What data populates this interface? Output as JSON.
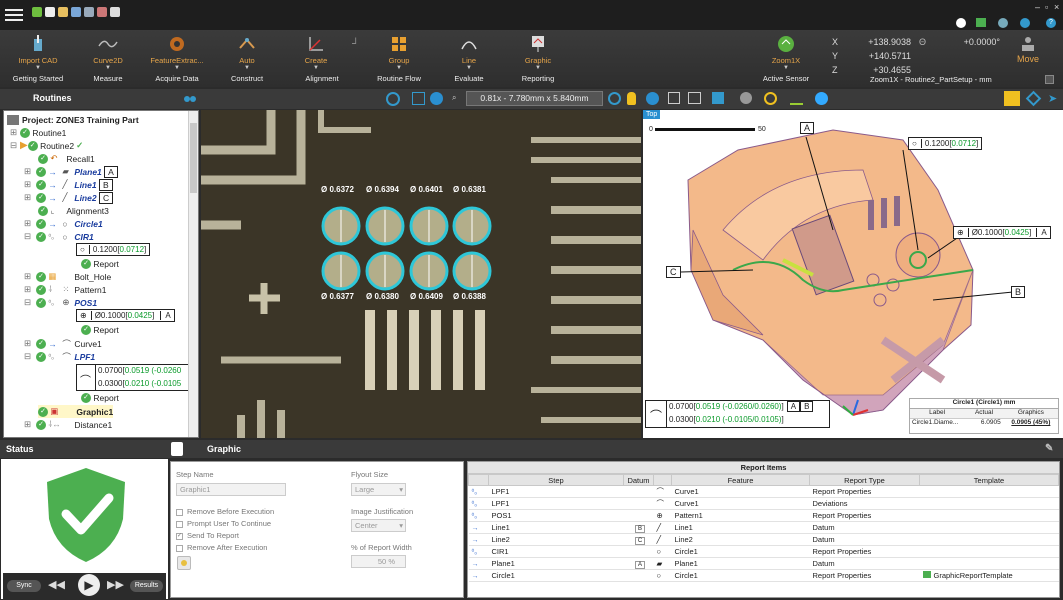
{
  "window": {
    "min": "–",
    "max": "▫",
    "close": "×"
  },
  "ribbon": {
    "buttons": [
      {
        "label": "Import CAD"
      },
      {
        "label": "Curve2D"
      },
      {
        "label": "FeatureExtrac..."
      },
      {
        "label": "Auto"
      },
      {
        "label": "Create"
      },
      {
        "label": "Group"
      },
      {
        "label": "Line"
      },
      {
        "label": "Graphic"
      },
      {
        "label": "Zoom1X"
      }
    ],
    "groups": [
      "Getting Started",
      "Measure",
      "Acquire Data",
      "Construct",
      "Alignment",
      "Routine Flow",
      "Evaluate",
      "Reporting",
      "Active Sensor"
    ],
    "coords": {
      "x_label": "X",
      "y_label": "Y",
      "z_label": "Z",
      "x": "+138.9038",
      "y": "+140.5711",
      "z": "+30.4655",
      "angle": "+0.0000°"
    },
    "move_label": "Move",
    "sensor_info": "Zoom1X - Routine2_PartSetup - mm"
  },
  "routines_title": "Routines",
  "viewport": {
    "zoom_text": "0.81x - 7.780mm x 5.840mm"
  },
  "tree": {
    "project": "Project: ZONE3 Training Part",
    "items": [
      {
        "label": "Routine1"
      },
      {
        "label": "Routine2"
      },
      {
        "label": "Recall1"
      },
      {
        "label": "Plane1",
        "datum": "A"
      },
      {
        "label": "Line1",
        "datum": "B"
      },
      {
        "label": "Line2",
        "datum": "C"
      },
      {
        "label": "Alignment3"
      },
      {
        "label": "Circle1"
      },
      {
        "label": "CIR1"
      },
      {
        "label": "0.1200",
        "tol": "0.0712"
      },
      {
        "label": "Report"
      },
      {
        "label": "Bolt_Hole"
      },
      {
        "label": "Pattern1"
      },
      {
        "label": "POS1"
      },
      {
        "label": "Ø0.1000",
        "tol": "0.0425",
        "datum": "A"
      },
      {
        "label": "Report"
      },
      {
        "label": "Curve1"
      },
      {
        "label": "LPF1"
      },
      {
        "label": "0.0700",
        "tol": "0.0519 (-0.0260"
      },
      {
        "label": "0.0300",
        "tol": "0.0210 (-0.0105"
      },
      {
        "label": "Report"
      },
      {
        "label": "Graphic1"
      },
      {
        "label": "Distance1"
      }
    ]
  },
  "camera": {
    "top_diams": [
      "Ø 0.6372",
      "Ø 0.6394",
      "Ø 0.6401",
      "Ø 0.6381"
    ],
    "bottom_diams": [
      "Ø 0.6377",
      "Ø 0.6380",
      "Ø 0.6409",
      "Ø 0.6388"
    ]
  },
  "cad": {
    "view_tag": "Top",
    "scale_start": "0",
    "scale_end": "50",
    "fcf_circle": {
      "nominal": "0.1200",
      "actual": "0.0712"
    },
    "fcf_pos": {
      "nominal": "Ø0.1000",
      "actual": "0.0425",
      "datum": "A"
    },
    "fcf_profile": [
      {
        "nominal": "0.0700",
        "actual": "0.0519 (-0.0260/0.0260)",
        "d1": "A",
        "d2": "B"
      },
      {
        "nominal": "0.0300",
        "actual": "0.0210 (-0.0105/0.0105)"
      }
    ],
    "labels": {
      "a": "A",
      "b": "B",
      "c": "C"
    },
    "report": {
      "title": "Circle1 (Circle1) mm",
      "h_label": "Label",
      "h_actual": "Actual",
      "h_graphics": "Graphics",
      "row_label": "Circle1.Diame...",
      "row_actual": "6.0905",
      "row_graphics": "0.0905 (45%)"
    }
  },
  "status": {
    "title": "Status",
    "panel_title": "Graphic",
    "sync": "Sync",
    "results": "Results"
  },
  "props": {
    "step_name_label": "Step Name",
    "step_name_value": "Graphic1",
    "flyout_label": "Flyout Size",
    "flyout_value": "Large",
    "just_label": "Image Justification",
    "just_value": "Center",
    "width_label": "% of Report Width",
    "width_value": "50 %",
    "checks": [
      "Remove Before Execution",
      "Prompt User To Continue",
      "Send To Report",
      "Remove After Execution"
    ]
  },
  "report_items": {
    "title": "Report Items",
    "headers": [
      "Step",
      "Datum",
      "Feature",
      "Report Type",
      "Template"
    ],
    "rows": [
      {
        "step": "LPF1",
        "datum": "",
        "feature": "Curve1",
        "type": "Report Properties",
        "template": ""
      },
      {
        "step": "LPF1",
        "datum": "",
        "feature": "Curve1",
        "type": "Deviations",
        "template": ""
      },
      {
        "step": "POS1",
        "datum": "",
        "feature": "Pattern1",
        "type": "Report Properties",
        "template": ""
      },
      {
        "step": "Line1",
        "datum": "B",
        "feature": "Line1",
        "type": "Datum",
        "template": ""
      },
      {
        "step": "Line2",
        "datum": "C",
        "feature": "Line2",
        "type": "Datum",
        "template": ""
      },
      {
        "step": "CIR1",
        "datum": "",
        "feature": "Circle1",
        "type": "Report Properties",
        "template": ""
      },
      {
        "step": "Plane1",
        "datum": "A",
        "feature": "Plane1",
        "type": "Datum",
        "template": ""
      },
      {
        "step": "Circle1",
        "datum": "",
        "feature": "Circle1",
        "type": "Report Properties",
        "template": "GraphicReportTemplate"
      }
    ]
  },
  "colors": {
    "accent": "#e6a54a",
    "check": "#4caf50",
    "tol_green": "#0a9a2a",
    "part": "#f0b080"
  }
}
